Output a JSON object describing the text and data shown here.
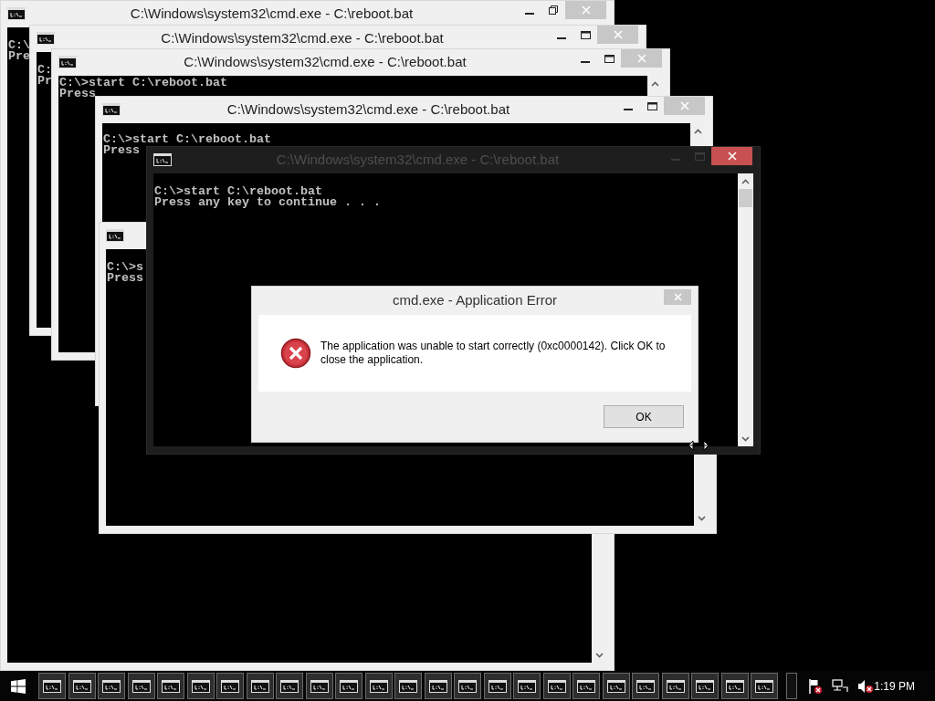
{
  "windows": [
    {
      "kind": "light",
      "title": "C:\\Windows\\system32\\cmd.exe - C:\\reboot.bat",
      "maximized": true,
      "active": false,
      "console_lines": [
        "C:\\",
        "Pre"
      ]
    },
    {
      "kind": "light",
      "title": "C:\\Windows\\system32\\cmd.exe - C:\\reboot.bat",
      "maximized": false,
      "active": false,
      "console_lines": [
        "C:",
        "Pr"
      ]
    },
    {
      "kind": "light",
      "title": "C:\\Windows\\system32\\cmd.exe - C:\\reboot.bat",
      "maximized": false,
      "active": false,
      "console_lines": [
        "C:\\>start C:\\reboot.bat",
        "Press"
      ]
    },
    {
      "kind": "light",
      "title": "C:\\Windows\\system32\\cmd.exe - C:\\reboot.bat",
      "maximized": false,
      "active": false,
      "console_lines": [
        "C:\\>start C:\\reboot.bat",
        "Press"
      ]
    },
    {
      "kind": "light",
      "console_lines": [
        "C:\\>s",
        "Press"
      ]
    },
    {
      "kind": "dark",
      "title": "C:\\Windows\\system32\\cmd.exe - C:\\reboot.bat",
      "maximized": false,
      "active": true,
      "console_lines": [
        "C:\\>start C:\\reboot.bat",
        "Press any key to continue . . ."
      ]
    }
  ],
  "dialog": {
    "title": "cmd.exe - Application Error",
    "message": "The application was unable to start correctly (0xc0000142). Click OK to close the application.",
    "button": "OK"
  },
  "taskbar": {
    "items": [
      {
        "kind": "cmd"
      },
      {
        "kind": "cmd"
      },
      {
        "kind": "cmd"
      },
      {
        "kind": "cmd"
      },
      {
        "kind": "cmd"
      },
      {
        "kind": "cmd"
      },
      {
        "kind": "cmd"
      },
      {
        "kind": "cmd"
      },
      {
        "kind": "cmd"
      },
      {
        "kind": "cmd"
      },
      {
        "kind": "cmd"
      },
      {
        "kind": "cmd"
      },
      {
        "kind": "cmd"
      },
      {
        "kind": "cmd"
      },
      {
        "kind": "cmd"
      },
      {
        "kind": "cmd"
      },
      {
        "kind": "cmd"
      },
      {
        "kind": "cmd"
      },
      {
        "kind": "cmd"
      },
      {
        "kind": "cmd"
      },
      {
        "kind": "cmd"
      },
      {
        "kind": "cmd"
      },
      {
        "kind": "cmd"
      },
      {
        "kind": "cmd"
      },
      {
        "kind": "cmd"
      },
      {
        "kind": "blank"
      }
    ],
    "clock": "1:19 PM"
  }
}
